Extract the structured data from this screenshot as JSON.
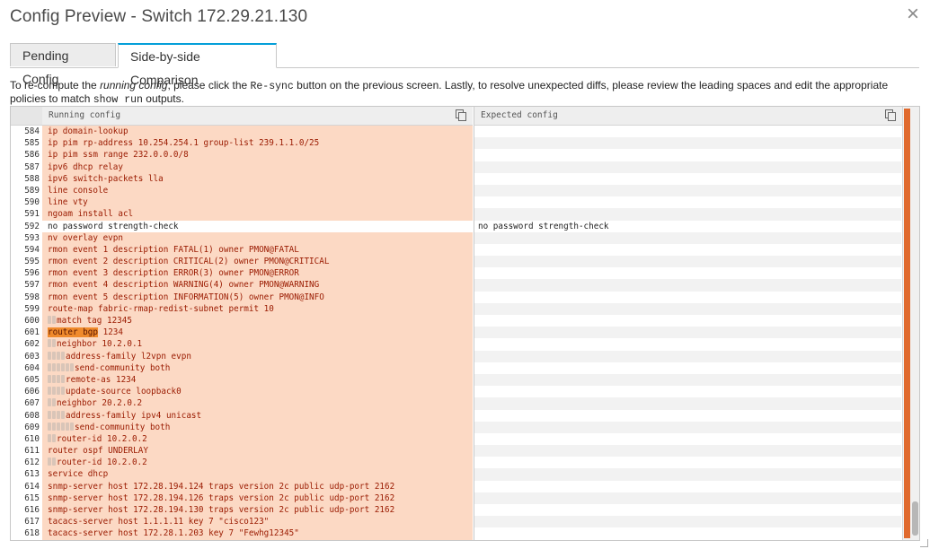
{
  "dialog": {
    "title": "Config Preview - Switch 172.29.21.130",
    "close_label": "×"
  },
  "tabs": [
    {
      "label": "Pending Config",
      "active": false
    },
    {
      "label": "Side-by-side Comparison",
      "active": true
    }
  ],
  "description": {
    "part1": "To re-compute the ",
    "italic": "running config",
    "part2": ", please click the ",
    "code1": "Re-sync",
    "part3": " button on the previous screen. Lastly, to resolve unexpected diffs, please review the leading spaces and edit the appropriate policies to match ",
    "code2": "show run",
    "part4": " outputs."
  },
  "diff": {
    "left_header": "Running config",
    "right_header": "Expected config",
    "colors": {
      "removed_bg": "#fcd9c4",
      "removed_text": "#9a1a00",
      "highlight": "#f08a2c",
      "tab_accent": "#049fd9"
    },
    "lines": [
      {
        "n": "584",
        "indent": 0,
        "left": "ip domain-lookup",
        "right": ""
      },
      {
        "n": "585",
        "indent": 0,
        "left": "ip pim rp-address 10.254.254.1 group-list 239.1.1.0/25",
        "right": ""
      },
      {
        "n": "586",
        "indent": 0,
        "left": "ip pim ssm range 232.0.0.0/8",
        "right": ""
      },
      {
        "n": "587",
        "indent": 0,
        "left": "ipv6 dhcp relay",
        "right": ""
      },
      {
        "n": "588",
        "indent": 0,
        "left": "ipv6 switch-packets lla",
        "right": ""
      },
      {
        "n": "589",
        "indent": 0,
        "left": "line console",
        "right": ""
      },
      {
        "n": "590",
        "indent": 0,
        "left": "line vty",
        "right": ""
      },
      {
        "n": "591",
        "indent": 0,
        "left": "ngoam install acl",
        "right": ""
      },
      {
        "n": "592",
        "indent": 0,
        "left": "no password strength-check",
        "right": "no password strength-check",
        "same": true
      },
      {
        "n": "593",
        "indent": 0,
        "left": "nv overlay evpn",
        "right": ""
      },
      {
        "n": "594",
        "indent": 0,
        "left": "rmon event 1 description FATAL(1) owner PMON@FATAL",
        "right": ""
      },
      {
        "n": "595",
        "indent": 0,
        "left": "rmon event 2 description CRITICAL(2) owner PMON@CRITICAL",
        "right": ""
      },
      {
        "n": "596",
        "indent": 0,
        "left": "rmon event 3 description ERROR(3) owner PMON@ERROR",
        "right": ""
      },
      {
        "n": "597",
        "indent": 0,
        "left": "rmon event 4 description WARNING(4) owner PMON@WARNING",
        "right": ""
      },
      {
        "n": "598",
        "indent": 0,
        "left": "rmon event 5 description INFORMATION(5) owner PMON@INFO",
        "right": ""
      },
      {
        "n": "599",
        "indent": 0,
        "left": "route-map fabric-rmap-redist-subnet permit 10",
        "right": ""
      },
      {
        "n": "600",
        "indent": 2,
        "left": "match tag 12345",
        "right": ""
      },
      {
        "n": "601",
        "indent": 0,
        "left": "1234",
        "highlight": "router bgp",
        "right": ""
      },
      {
        "n": "602",
        "indent": 2,
        "left": "neighbor 10.2.0.1",
        "right": ""
      },
      {
        "n": "603",
        "indent": 4,
        "left": "address-family l2vpn evpn",
        "right": ""
      },
      {
        "n": "604",
        "indent": 6,
        "left": "send-community both",
        "right": ""
      },
      {
        "n": "605",
        "indent": 4,
        "left": "remote-as 1234",
        "right": ""
      },
      {
        "n": "606",
        "indent": 4,
        "left": "update-source loopback0",
        "right": ""
      },
      {
        "n": "607",
        "indent": 2,
        "left": "neighbor 20.2.0.2",
        "right": ""
      },
      {
        "n": "608",
        "indent": 4,
        "left": "address-family ipv4 unicast",
        "right": ""
      },
      {
        "n": "609",
        "indent": 6,
        "left": "send-community both",
        "right": ""
      },
      {
        "n": "610",
        "indent": 2,
        "left": "router-id 10.2.0.2",
        "right": ""
      },
      {
        "n": "611",
        "indent": 0,
        "left": "router ospf UNDERLAY",
        "right": ""
      },
      {
        "n": "612",
        "indent": 2,
        "left": "router-id 10.2.0.2",
        "right": ""
      },
      {
        "n": "613",
        "indent": 0,
        "left": "service dhcp",
        "right": ""
      },
      {
        "n": "614",
        "indent": 0,
        "left": "snmp-server host 172.28.194.124 traps version 2c public udp-port 2162",
        "right": ""
      },
      {
        "n": "615",
        "indent": 0,
        "left": "snmp-server host 172.28.194.126 traps version 2c public udp-port 2162",
        "right": ""
      },
      {
        "n": "616",
        "indent": 0,
        "left": "snmp-server host 172.28.194.130 traps version 2c public udp-port 2162",
        "right": ""
      },
      {
        "n": "617",
        "indent": 0,
        "left": "tacacs-server host 1.1.1.11 key 7 \"cisco123\"",
        "right": ""
      },
      {
        "n": "618",
        "indent": 0,
        "left": "tacacs-server host 172.28.1.203 key 7 \"Fewhg12345\"",
        "right": ""
      }
    ]
  }
}
